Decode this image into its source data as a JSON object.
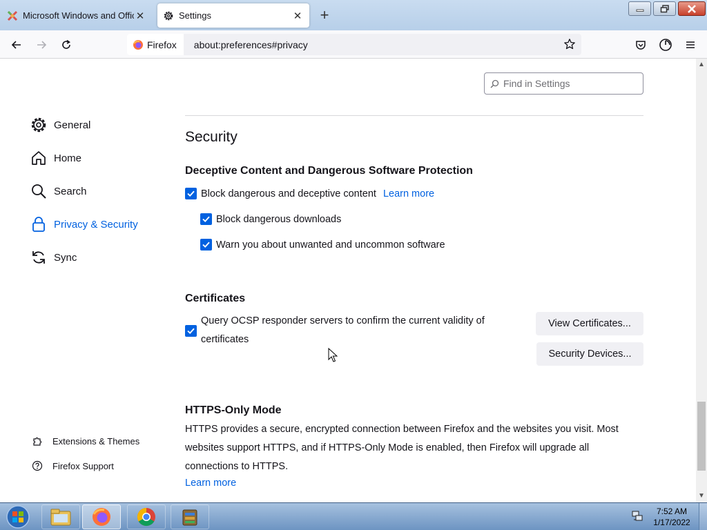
{
  "browser": {
    "tabs": [
      {
        "title": "Microsoft Windows and Office",
        "icon": "tool-icon",
        "active": false
      },
      {
        "title": "Settings",
        "icon": "gear-icon",
        "active": true
      }
    ],
    "identity_label": "Firefox",
    "url": "about:preferences#privacy"
  },
  "search": {
    "placeholder": "Find in Settings"
  },
  "sidebar": {
    "items": [
      {
        "label": "General",
        "icon": "gear-icon",
        "selected": false
      },
      {
        "label": "Home",
        "icon": "home-icon",
        "selected": false
      },
      {
        "label": "Search",
        "icon": "search-icon",
        "selected": false
      },
      {
        "label": "Privacy & Security",
        "icon": "lock-icon",
        "selected": true
      },
      {
        "label": "Sync",
        "icon": "sync-icon",
        "selected": false
      }
    ],
    "footer": [
      {
        "label": "Extensions & Themes",
        "icon": "puzzle-icon"
      },
      {
        "label": "Firefox Support",
        "icon": "help-icon"
      }
    ]
  },
  "main": {
    "section_title": "Security",
    "deceptive": {
      "heading": "Deceptive Content and Dangerous Software Protection",
      "block_content": {
        "label": "Block dangerous and deceptive content",
        "checked": true
      },
      "learn_more": "Learn more",
      "block_downloads": {
        "label": "Block dangerous downloads",
        "checked": true
      },
      "warn_unwanted": {
        "label": "Warn you about unwanted and uncommon software",
        "checked": true
      }
    },
    "certificates": {
      "heading": "Certificates",
      "ocsp": {
        "label": "Query OCSP responder servers to confirm the current validity of certificates",
        "checked": true
      },
      "view_button": "View Certificates...",
      "devices_button": "Security Devices..."
    },
    "https_only": {
      "heading": "HTTPS-Only Mode",
      "description": "HTTPS provides a secure, encrypted connection between Firefox and the websites you visit. Most websites support HTTPS, and if HTTPS-Only Mode is enabled, then Firefox will upgrade all connections to HTTPS.",
      "learn_more": "Learn more"
    }
  },
  "taskbar": {
    "time": "7:52 AM",
    "date": "1/17/2022",
    "apps": [
      "file-explorer-icon",
      "firefox-icon",
      "chrome-icon",
      "archive-icon"
    ]
  },
  "colors": {
    "accent": "#0061e0",
    "text": "#15141a"
  }
}
